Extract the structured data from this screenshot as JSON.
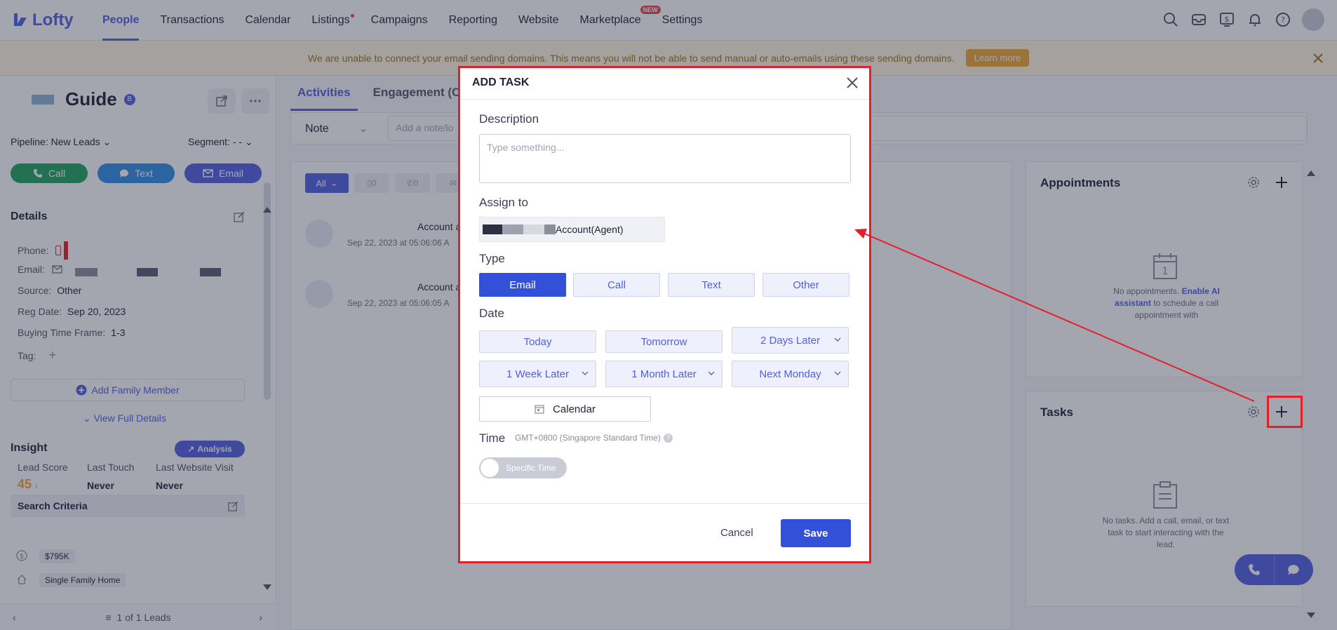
{
  "nav": {
    "logo": "Lofty",
    "items": [
      "People",
      "Transactions",
      "Calendar",
      "Listings",
      "Campaigns",
      "Reporting",
      "Website",
      "Marketplace",
      "Settings"
    ],
    "new_badge": "NEW"
  },
  "warning": {
    "message": "We are unable to connect your email sending domains. This means you will not be able to send manual or auto-emails using these sending domains.",
    "learn_more": "Learn more"
  },
  "lead": {
    "name": "Guide",
    "badge": "B",
    "pipeline_label": "Pipeline:",
    "pipeline_value": "New Leads",
    "segment_label": "Segment:",
    "segment_value": "- -",
    "call": "Call",
    "text": "Text",
    "email": "Email",
    "details_title": "Details",
    "phone_label": "Phone:",
    "email_label": "Email:",
    "source_label": "Source:",
    "source_value": "Other",
    "reg_label": "Reg Date:",
    "reg_value": "Sep 20, 2023",
    "btf_label": "Buying Time Frame:",
    "btf_value": "1-3",
    "tag_label": "Tag:",
    "add_family": "Add Family Member",
    "view_full": "View Full Details",
    "insight_title": "Insight",
    "analysis": "Analysis",
    "lead_score_label": "Lead Score",
    "lead_score_value": "45",
    "last_touch_label": "Last Touch",
    "last_touch_value": "Never",
    "last_visit_label": "Last Website Visit",
    "last_visit_value": "Never",
    "search_criteria": "Search Criteria",
    "price": "$795K",
    "home_type": "Single Family Home",
    "pager": "1 of 1 Leads"
  },
  "center": {
    "tabs": [
      "Activities",
      "Engagement (C"
    ],
    "note_select": "Note",
    "note_placeholder": "Add a note/lo",
    "filter_all": "All",
    "filter_counts": [
      "0",
      "0"
    ],
    "activities": [
      {
        "title": "Account a",
        "time": "Sep 22, 2023 at 05:06:06 A"
      },
      {
        "title": "Account a",
        "time": "Sep 22, 2023 at 05:06:05 A"
      }
    ]
  },
  "right": {
    "appointments_title": "Appointments",
    "appointments_empty_1": "No appointments.",
    "appointments_link": "Enable AI assistant",
    "appointments_empty_2": "to schedule a call appointment with",
    "calendar_digit": "1",
    "tasks_title": "Tasks",
    "tasks_empty": "No tasks. Add a call, email, or text task to start interacting with the lead."
  },
  "modal": {
    "title": "ADD TASK",
    "description_label": "Description",
    "description_placeholder": "Type something...",
    "assign_label": "Assign to",
    "assign_value": "Account(Agent)",
    "type_label": "Type",
    "types": [
      "Email",
      "Call",
      "Text",
      "Other"
    ],
    "selected_type": "Email",
    "date_label": "Date",
    "dates": [
      "Today",
      "Tomorrow",
      "2 Days Later",
      "1 Week Later",
      "1 Month Later",
      "Next Monday"
    ],
    "calendar": "Calendar",
    "time_label": "Time",
    "timezone": "GMT+0800 (Singapore Standard Time)",
    "specific_time": "Specific Time",
    "cancel": "Cancel",
    "save": "Save"
  },
  "colors": {
    "primary": "#515fe0",
    "call": "#20a461",
    "text": "#2f8ee6",
    "annotation": "#e3202a"
  }
}
